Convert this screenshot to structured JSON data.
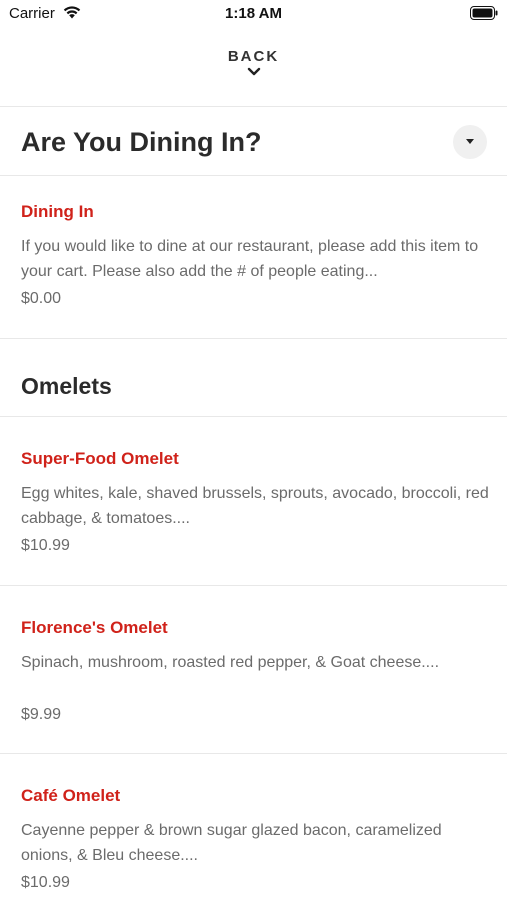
{
  "status_bar": {
    "carrier": "Carrier",
    "time": "1:18 AM"
  },
  "nav": {
    "back_label": "BACK"
  },
  "sections": [
    {
      "title": "Are You Dining In?",
      "items": [
        {
          "name": "Dining In",
          "description": "If you would like to dine at our restaurant, please add this item to your cart. Please also add the # of people eating...",
          "price": "$0.00"
        }
      ]
    },
    {
      "title": "Omelets",
      "items": [
        {
          "name": "Super-Food Omelet",
          "description": "Egg whites, kale, shaved brussels, sprouts, avocado, broccoli, red cabbage, & tomatoes....",
          "price": "$10.99"
        },
        {
          "name": "Florence's Omelet",
          "description": "Spinach, mushroom, roasted red pepper, & Goat cheese....",
          "price": "$9.99"
        },
        {
          "name": "Café Omelet",
          "description": "Cayenne pepper & brown sugar glazed bacon, caramelized onions, & Bleu cheese....",
          "price": "$10.99"
        }
      ]
    }
  ],
  "colors": {
    "item_name": "#d0221a",
    "description": "#6b6b6b",
    "title": "#2b2b2b",
    "divider": "#e8e8e8"
  },
  "icons": {
    "wifi": "wifi-icon",
    "battery": "battery-icon",
    "back_chevron": "chevron-down-icon",
    "dropdown": "caret-down-icon"
  }
}
